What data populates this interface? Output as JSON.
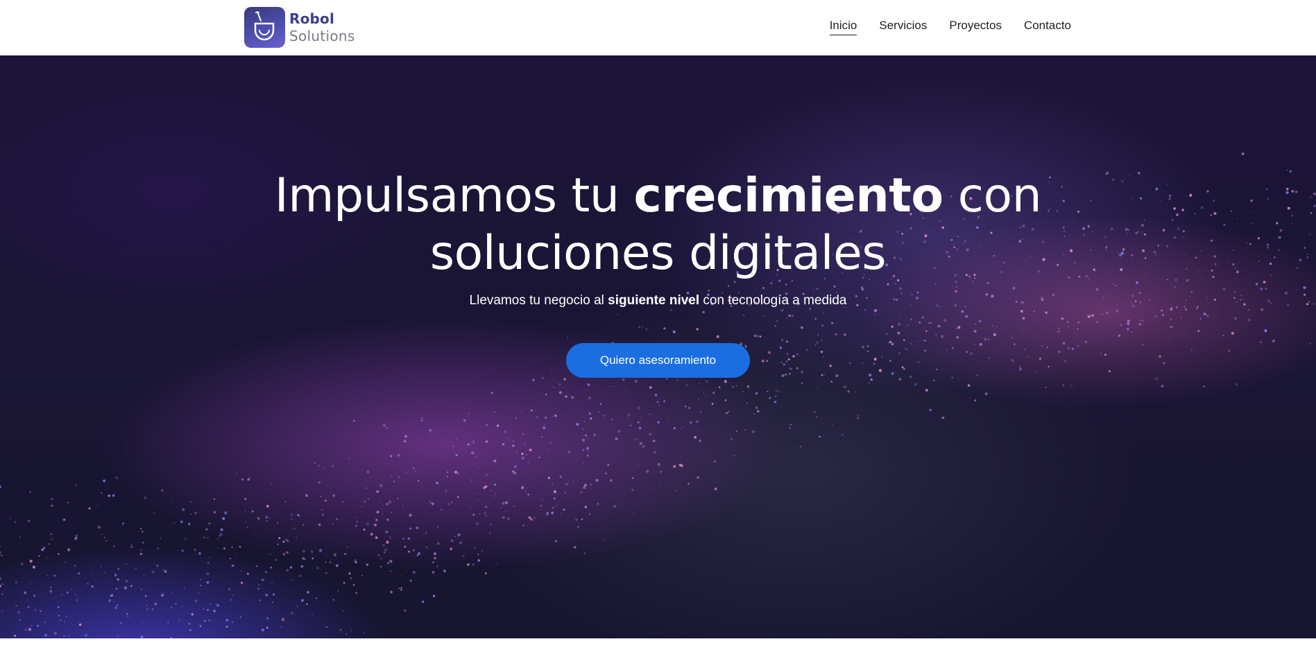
{
  "brand": {
    "name_line1": "Robol",
    "name_line2": "Solutions",
    "logo_icon": "cup-with-straw-icon",
    "colors": {
      "primary": "#3c3f8f",
      "secondary": "#7a7a82"
    }
  },
  "nav": {
    "items": [
      {
        "label": "Inicio",
        "active": true
      },
      {
        "label": "Servicios",
        "active": false
      },
      {
        "label": "Proyectos",
        "active": false
      },
      {
        "label": "Contacto",
        "active": false
      }
    ]
  },
  "hero": {
    "title_part1": "Impulsamos tu ",
    "title_bold": "crecimiento",
    "title_part2": " con",
    "title_line2": "soluciones digitales",
    "subtitle_part1": "Llevamos tu negocio al ",
    "subtitle_bold": "siguiente nivel",
    "subtitle_part2": " con tecnología a medida",
    "cta_label": "Quiero asesoramiento",
    "cta_color": "#1a6ee0"
  }
}
